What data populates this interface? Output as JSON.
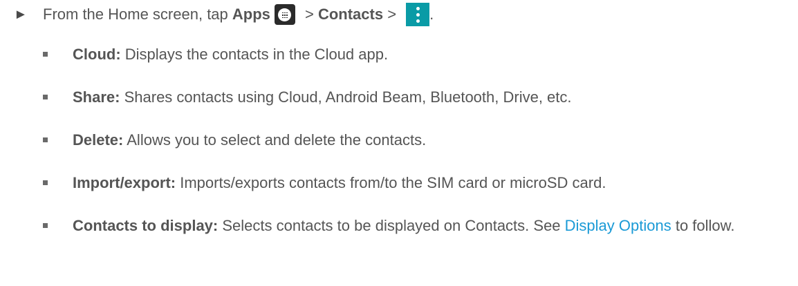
{
  "step": {
    "arrow": "►",
    "text_before": "From the Home screen, tap ",
    "apps_label": "Apps",
    "sep1": " > ",
    "contacts_label": "Contacts",
    "sep2": " > ",
    "end": ".",
    "icons": [
      "apps-icon",
      "menu-icon"
    ],
    "menu_icon_color": "#0a9ba6"
  },
  "items": [
    {
      "label": "Cloud:",
      "desc": " Displays the contacts in the Cloud app."
    },
    {
      "label": "Share:",
      "desc": " Shares contacts using Cloud, Android Beam, Bluetooth, Drive, etc."
    },
    {
      "label": "Delete:",
      "desc": " Allows you to select and delete the contacts."
    },
    {
      "label": "Import/export:",
      "desc": " Imports/exports contacts from/to the SIM card or microSD card."
    },
    {
      "label": "Contacts to display:",
      "desc": " Selects contacts to be displayed on Contacts. See ",
      "link": "Display Options",
      "desc_after": " to follow."
    }
  ],
  "link_color": "#1a9ad6"
}
